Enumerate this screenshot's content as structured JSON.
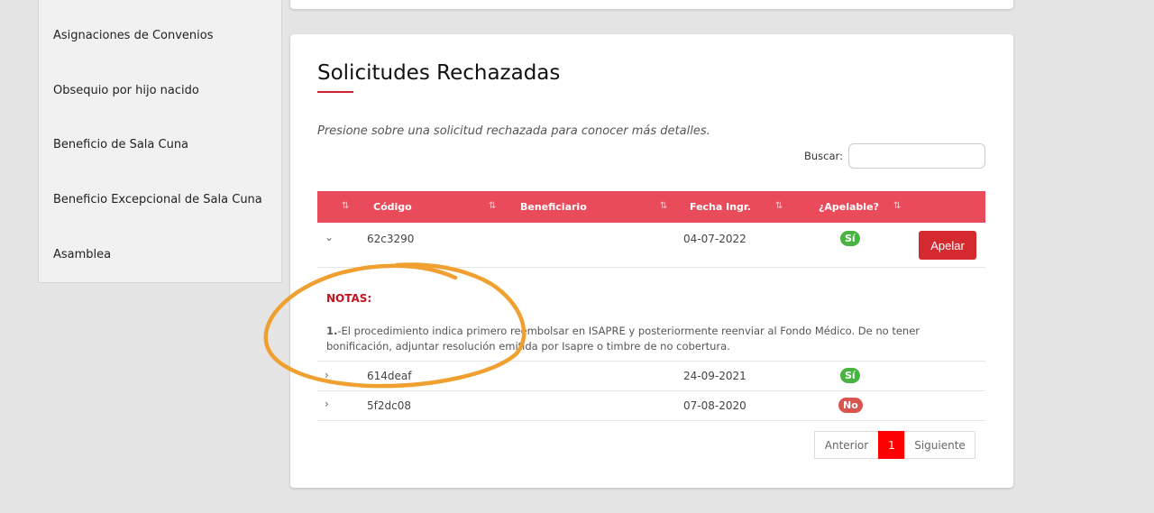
{
  "sidebar": {
    "items": [
      {
        "label": "Asignaciones de Convenios"
      },
      {
        "label": "Obsequio por hijo nacido"
      },
      {
        "label": "Beneficio de Sala Cuna"
      },
      {
        "label": "Beneficio Excepcional de Sala Cuna"
      },
      {
        "label": "Asamblea"
      }
    ]
  },
  "main": {
    "title": "Solicitudes Rechazadas",
    "hint": "Presione sobre una solicitud rechazada para conocer más detalles.",
    "search": {
      "label": "Buscar:",
      "value": ""
    },
    "table": {
      "headers": [
        "Código",
        "Beneficiario",
        "Fecha Ingr.",
        "¿Apelable?"
      ],
      "rows": [
        {
          "code": "62c3290",
          "date": "04-07-2022",
          "apelable": "Sí",
          "action": "Apelar"
        },
        {
          "code": "614deaf",
          "date": "24-09-2021",
          "apelable": "Sí"
        },
        {
          "code": "5f2dc08",
          "date": "07-08-2020",
          "apelable": "No"
        }
      ]
    },
    "notes": {
      "title": "NOTAS:",
      "number": "1.",
      "text": "-El procedimiento indica primero reembolsar en ISAPRE y posteriormente reenviar al Fondo Médico. De no tener bonificación, adjuntar resolución emitida por Isapre o timbre de no cobertura."
    },
    "pagination": {
      "prev": "Anterior",
      "current": "1",
      "next": "Siguiente"
    }
  },
  "colors": {
    "accent": "#ea4b5b",
    "brand_red": "#d42a2f",
    "annotation_orange": "#f0a030"
  }
}
